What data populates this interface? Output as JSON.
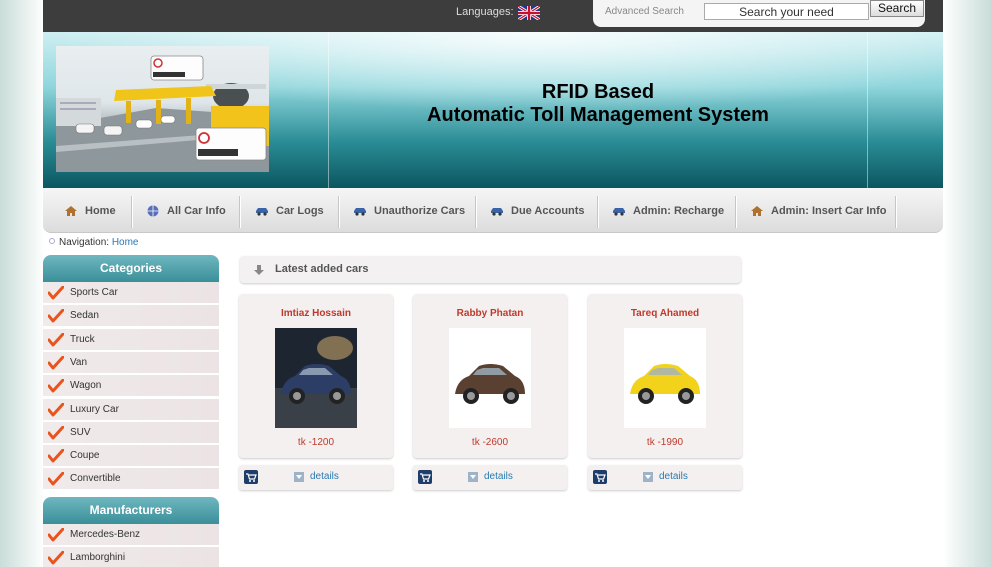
{
  "header": {
    "languages_label": "Languages:",
    "language_flag": "uk-flag-icon",
    "advanced_search": "Advanced Search",
    "search_placeholder": "Search your need",
    "search_button": "Search"
  },
  "banner": {
    "title_line1": "RFID Based",
    "title_line2": "Automatic Toll Management System"
  },
  "nav": {
    "items": [
      {
        "label": "Home",
        "icon": "home-icon"
      },
      {
        "label": "All Car Info",
        "icon": "globe-icon"
      },
      {
        "label": "Car Logs",
        "icon": "car-icon"
      },
      {
        "label": "Unauthorize Cars",
        "icon": "car-icon"
      },
      {
        "label": "Due Accounts",
        "icon": "car-icon"
      },
      {
        "label": "Admin: Recharge",
        "icon": "car-icon"
      },
      {
        "label": "Admin: Insert Car Info",
        "icon": "home-icon"
      }
    ]
  },
  "breadcrumb": {
    "label": "Navigation:",
    "link": "Home"
  },
  "sidebar": {
    "categories_title": "Categories",
    "categories": [
      "Sports Car",
      "Sedan",
      "Truck",
      "Van",
      "Wagon",
      "Luxury Car",
      "SUV",
      "Coupe",
      "Convertible"
    ],
    "manufacturers_title": "Manufacturers",
    "manufacturers": [
      "Mercedes-Benz",
      "Lamborghini"
    ]
  },
  "main": {
    "section_title": "Latest added cars",
    "cards": [
      {
        "name": "Imtiaz Hossain",
        "price": "tk -1200",
        "details": "details",
        "car_color": "#2c3e66"
      },
      {
        "name": "Rabby Phatan",
        "price": "tk -2600",
        "details": "details",
        "car_color": "#5a4030"
      },
      {
        "name": "Tareq Ahamed",
        "price": "tk -1990",
        "details": "details",
        "car_color": "#f2d21b"
      }
    ]
  },
  "colors": {
    "accent_teal": "#3a8f99",
    "link_blue": "#2a7ab0",
    "price_red": "#c0392b"
  }
}
